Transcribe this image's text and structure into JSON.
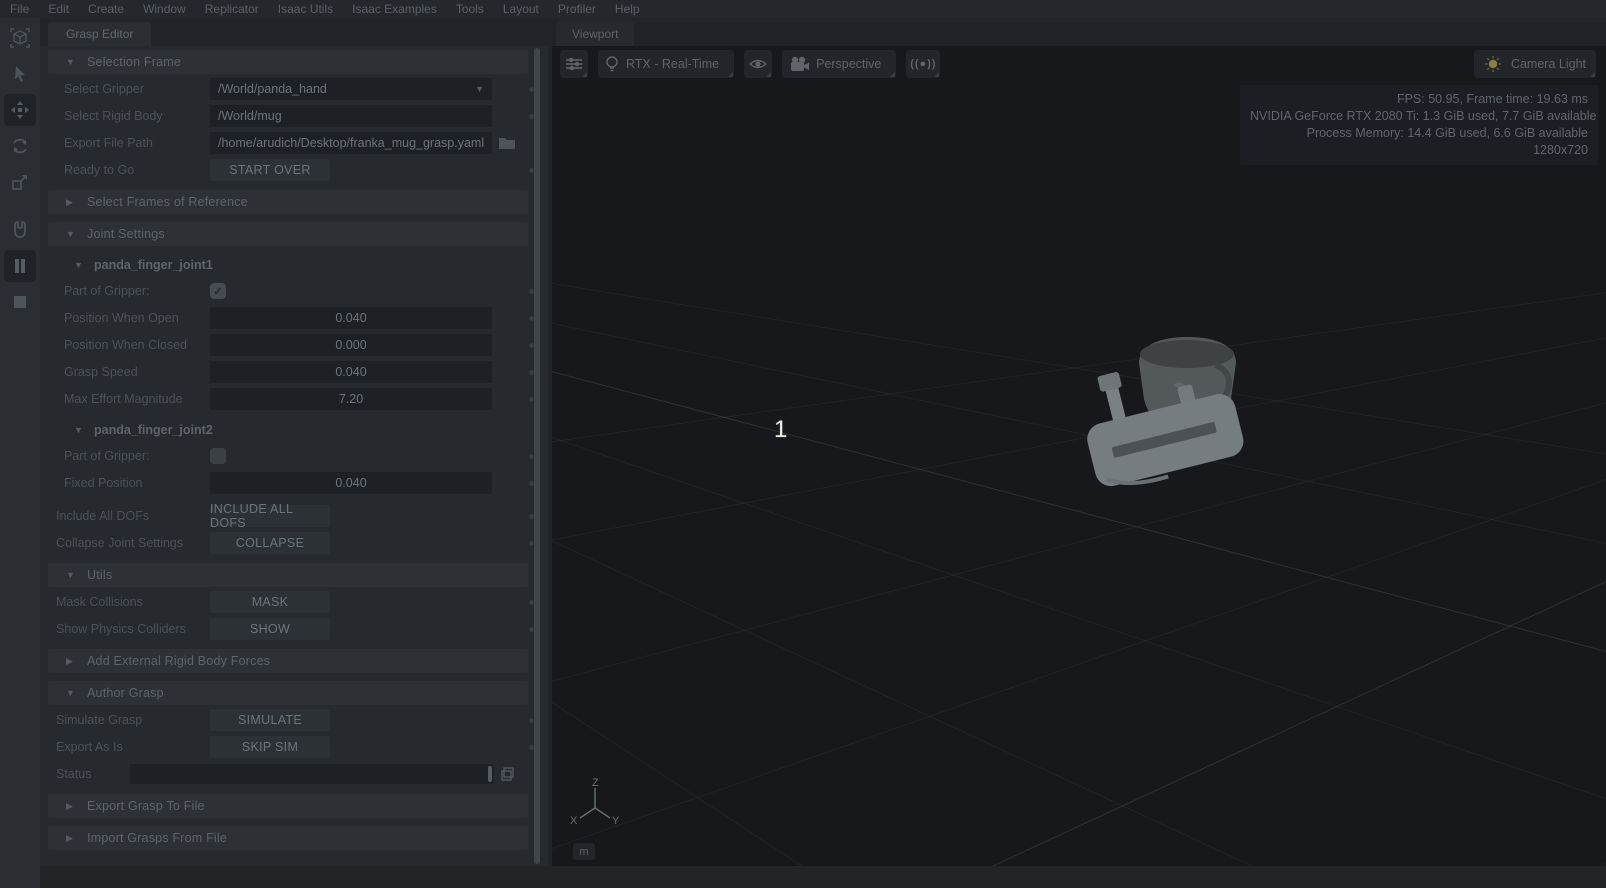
{
  "menu": {
    "items": [
      "File",
      "Edit",
      "Create",
      "Window",
      "Replicator",
      "Isaac Utils",
      "Isaac Examples",
      "Tools",
      "Layout",
      "Profiler",
      "Help"
    ]
  },
  "left_toolbar": {
    "icons": [
      "select-prim-icon",
      "pointer-icon",
      "move-icon",
      "rotate-icon",
      "scale-icon",
      "snap-magnet-icon",
      "pause-icon",
      "stop-icon"
    ]
  },
  "panel": {
    "tab": "Grasp Editor",
    "selection_frame": {
      "title": "Selection Frame",
      "select_gripper_label": "Select Gripper",
      "select_gripper_value": "/World/panda_hand",
      "select_rigid_body_label": "Select Rigid Body",
      "select_rigid_body_value": "/World/mug",
      "export_file_path_label": "Export File Path",
      "export_file_path_value": "/home/arudich/Desktop/franka_mug_grasp.yaml",
      "ready_to_go_label": "Ready to Go",
      "start_over_button": "START OVER"
    },
    "select_frames_header": "Select Frames of Reference",
    "joint_settings": {
      "title": "Joint Settings",
      "joint1": {
        "title": "panda_finger_joint1",
        "part_of_gripper_label": "Part of Gripper:",
        "part_of_gripper_checked": true,
        "rows": [
          {
            "label": "Position When Open",
            "value": "0.040"
          },
          {
            "label": "Position When Closed",
            "value": "0.000"
          },
          {
            "label": "Grasp Speed",
            "value": "0.040"
          },
          {
            "label": "Max Effort Magnitude",
            "value": "7.20"
          }
        ]
      },
      "joint2": {
        "title": "panda_finger_joint2",
        "part_of_gripper_label": "Part of Gripper:",
        "part_of_gripper_checked": false,
        "fixed_position_label": "Fixed Position",
        "fixed_position_value": "0.040"
      },
      "include_all_dofs_label": "Include All DOFs",
      "include_all_dofs_button": "INCLUDE ALL DOFS",
      "collapse_label": "Collapse Joint Settings",
      "collapse_button": "COLLAPSE"
    },
    "utils": {
      "title": "Utils",
      "mask_collisions_label": "Mask Collisions",
      "mask_button": "MASK",
      "show_colliders_label": "Show Physics Colliders",
      "show_button": "SHOW"
    },
    "add_forces_header": "Add External Rigid Body Forces",
    "author_grasp": {
      "title": "Author Grasp",
      "simulate_label": "Simulate Grasp",
      "simulate_button": "SIMULATE",
      "export_label": "Export As Is",
      "skip_button": "SKIP SIM",
      "status_label": "Status",
      "status_value": ""
    },
    "export_header": "Export Grasp To File",
    "import_header": "Import Grasps From File"
  },
  "viewport": {
    "tab": "Viewport",
    "toolbar": {
      "render_mode": "RTX - Real-Time",
      "camera": "Perspective",
      "broadcast_glyph": "((●))",
      "camera_light": "Camera Light"
    },
    "stats": {
      "line1": "FPS: 50.95, Frame time: 19.63 ms",
      "line2": "NVIDIA GeForce RTX 2080 Ti: 1.3 GiB used, 7.7 GiB available",
      "line3": "Process Memory: 14.4 GiB used, 6.6 GiB available",
      "line4": "1280x720"
    },
    "grasp_marker": "1",
    "axis": {
      "x": "X",
      "y": "Y",
      "z": "Z",
      "units": "m"
    },
    "scene_objects": [
      "mug",
      "panda-gripper"
    ]
  },
  "colors": {
    "camera_light_icon": "#8d7d47",
    "marker": "#e9edf0",
    "viewport_bg": "#16181b",
    "panel_bg": "#26292d",
    "field_bg": "#1d2125"
  }
}
